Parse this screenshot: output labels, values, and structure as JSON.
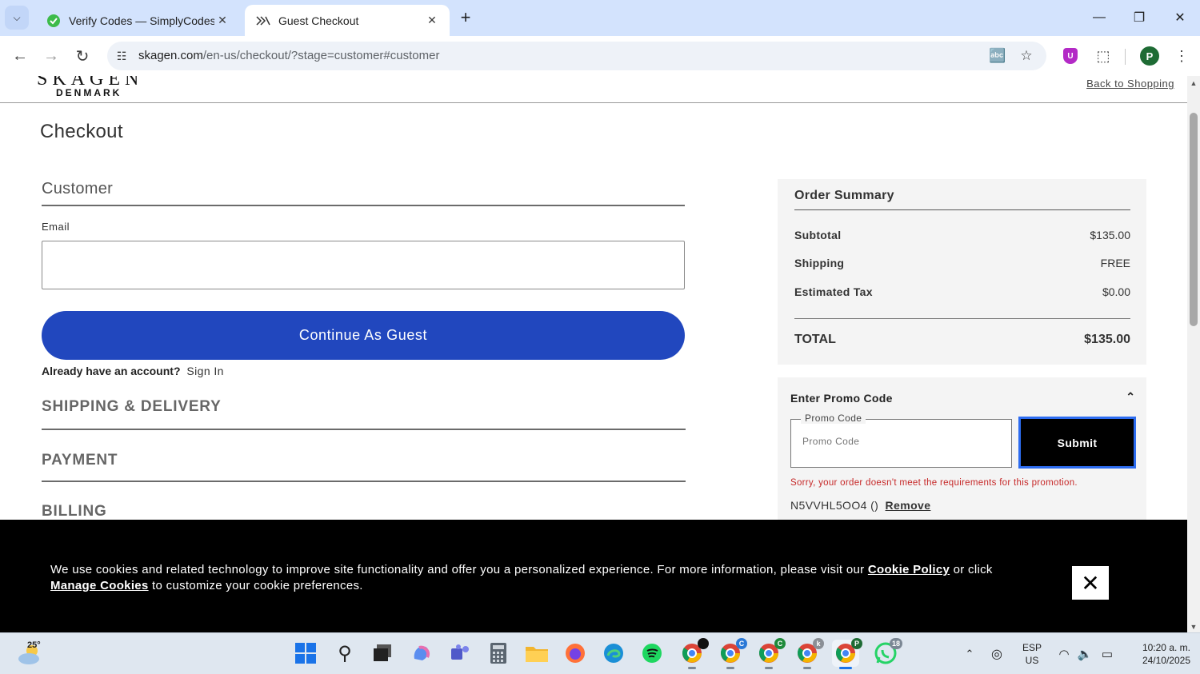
{
  "browser": {
    "tabs": [
      {
        "title": "Verify Codes — SimplyCodes",
        "active": false
      },
      {
        "title": "Guest Checkout",
        "active": true
      }
    ],
    "url_host": "skagen.com",
    "url_path": "/en-us/checkout/?stage=customer#customer",
    "profile_initial": "P",
    "extension_badge": "U"
  },
  "header": {
    "logo_top": "SKAGEN",
    "logo_sub": "DENMARK",
    "back_link": "Back to Shopping"
  },
  "page_title": "Checkout",
  "customer": {
    "heading": "Customer",
    "email_label": "Email",
    "email_value": "",
    "guest_button": "Continue As Guest",
    "account_question": "Already have an account?",
    "sign_in": "Sign In"
  },
  "sections": {
    "shipping": "SHIPPING & DELIVERY",
    "payment": "PAYMENT",
    "billing": "BILLING"
  },
  "summary": {
    "title": "Order Summary",
    "subtotal_label": "Subtotal",
    "subtotal_value": "$135.00",
    "shipping_label": "Shipping",
    "shipping_value": "FREE",
    "tax_label": "Estimated Tax",
    "tax_value": "$0.00",
    "total_label": "TOTAL",
    "total_value": "$135.00"
  },
  "promo": {
    "title": "Enter Promo Code",
    "field_label": "Promo Code",
    "placeholder": "Promo Code",
    "submit": "Submit",
    "error": "Sorry, your order doesn't meet the requirements for this promotion.",
    "applied_code": "N5VVHL5OO4 ()",
    "remove": "Remove"
  },
  "cookie": {
    "text_1": "We use cookies and related technology to improve site functionality and offer you a personalized experience. For more information, please visit our ",
    "policy_link": "Cookie Policy",
    "text_2": " or click ",
    "manage_link": "Manage Cookies",
    "text_3": " to customize your cookie preferences."
  },
  "taskbar": {
    "temperature": "25°",
    "language_1": "ESP",
    "language_2": "US",
    "time": "10:20 a. m.",
    "date": "24/10/2025",
    "whatsapp_badge": "18",
    "chrome_profile_badges": [
      "",
      "C",
      "C",
      "k",
      "P"
    ]
  },
  "colors": {
    "brand_button": "#2147be",
    "error": "#c62828",
    "tabbar": "#d3e3fd"
  }
}
